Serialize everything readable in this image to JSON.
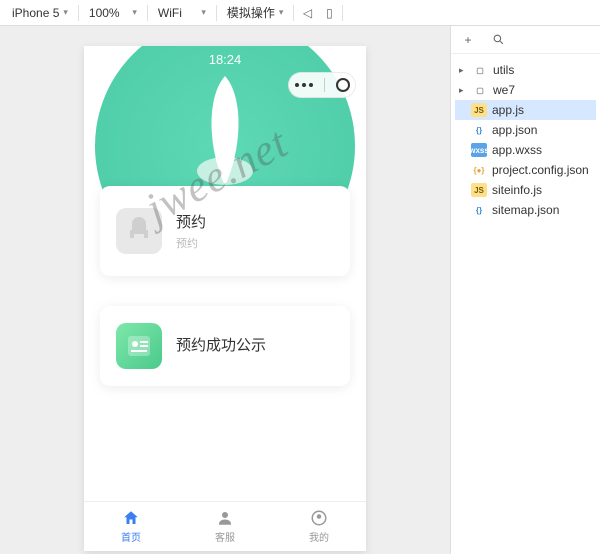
{
  "toolbar": {
    "device": "iPhone 5",
    "zoom": "100%",
    "network": "WiFi",
    "sim": "模拟操作"
  },
  "phone": {
    "time": "18:24",
    "card1": {
      "title": "预约",
      "sub": "预约"
    },
    "card2": {
      "title": "预约成功公示"
    },
    "tabs": [
      {
        "label": "首页"
      },
      {
        "label": "客服"
      },
      {
        "label": "我的"
      }
    ]
  },
  "files": {
    "folders": [
      "utils",
      "we7"
    ],
    "items": [
      {
        "name": "app.js",
        "type": "js"
      },
      {
        "name": "app.json",
        "type": "json"
      },
      {
        "name": "app.wxss",
        "type": "wxss"
      },
      {
        "name": "project.config.json",
        "type": "json"
      },
      {
        "name": "siteinfo.js",
        "type": "js"
      },
      {
        "name": "sitemap.json",
        "type": "json"
      }
    ]
  },
  "watermark": "jwee.net"
}
